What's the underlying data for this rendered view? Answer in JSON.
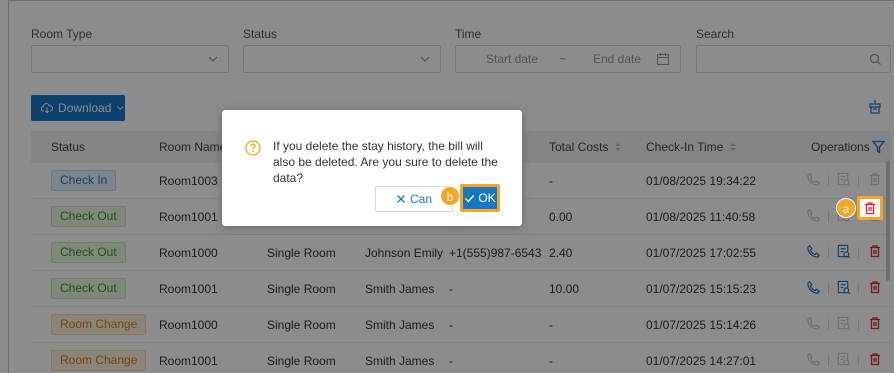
{
  "filters": {
    "room_type_label": "Room Type",
    "status_label": "Status",
    "time_label": "Time",
    "search_label": "Search",
    "start_date_placeholder": "Start date",
    "date_separator": "~",
    "end_date_placeholder": "End date"
  },
  "toolbar": {
    "download_label": "Download"
  },
  "table": {
    "headers": {
      "status": "Status",
      "room_name": "Room Name",
      "total_costs": "Total Costs",
      "check_in_time": "Check-In Time",
      "operations": "Operations"
    },
    "rows": [
      {
        "status": "Check In",
        "status_type": "in",
        "room_name": "Room1003",
        "room_type": "",
        "guest": "",
        "phone": "",
        "total_costs": "-",
        "check_in_time": "01/08/2025 19:34:22",
        "ops_enabled": false
      },
      {
        "status": "Check Out",
        "status_type": "out",
        "room_name": "Room1001",
        "room_type": "",
        "guest": "",
        "phone": "",
        "total_costs": "0.00",
        "check_in_time": "01/08/2025 11:40:58",
        "ops_enabled": false
      },
      {
        "status": "Check Out",
        "status_type": "out",
        "room_name": "Room1000",
        "room_type": "Single Room",
        "guest": "Johnson Emily",
        "phone": "+1(555)987-6543",
        "total_costs": "2.40",
        "check_in_time": "01/07/2025 17:02:55",
        "ops_enabled": true
      },
      {
        "status": "Check Out",
        "status_type": "out",
        "room_name": "Room1001",
        "room_type": "Single Room",
        "guest": "Smith James",
        "phone": "-",
        "total_costs": "10.00",
        "check_in_time": "01/07/2025 15:15:23",
        "ops_enabled": true
      },
      {
        "status": "Room Change",
        "status_type": "change",
        "room_name": "Room1000",
        "room_type": "Single Room",
        "guest": "Smith James",
        "phone": "-",
        "total_costs": "-",
        "check_in_time": "01/07/2025 15:14:26",
        "ops_enabled": false
      },
      {
        "status": "Room Change",
        "status_type": "change",
        "room_name": "Room1001",
        "room_type": "Single Room",
        "guest": "Smith James",
        "phone": "-",
        "total_costs": "-",
        "check_in_time": "01/07/2025 14:27:01",
        "ops_enabled": false
      }
    ]
  },
  "modal": {
    "message": "If you delete the stay history, the bill will also be deleted. Are you sure to delete the data?",
    "cancel_label": "Can",
    "ok_label": "OK"
  },
  "annotations": {
    "a": "a",
    "b": "b"
  },
  "colors": {
    "primary": "#1677c9",
    "highlight": "#f5a623",
    "delete": "#e0282e"
  },
  "icons": [
    "chevron-down-icon",
    "calendar-icon",
    "search-icon",
    "download-cloud-icon",
    "table-settings-icon",
    "sort-icon",
    "filter-icon",
    "phone-icon",
    "bill-icon",
    "delete-icon",
    "question-icon",
    "close-icon",
    "check-icon"
  ]
}
